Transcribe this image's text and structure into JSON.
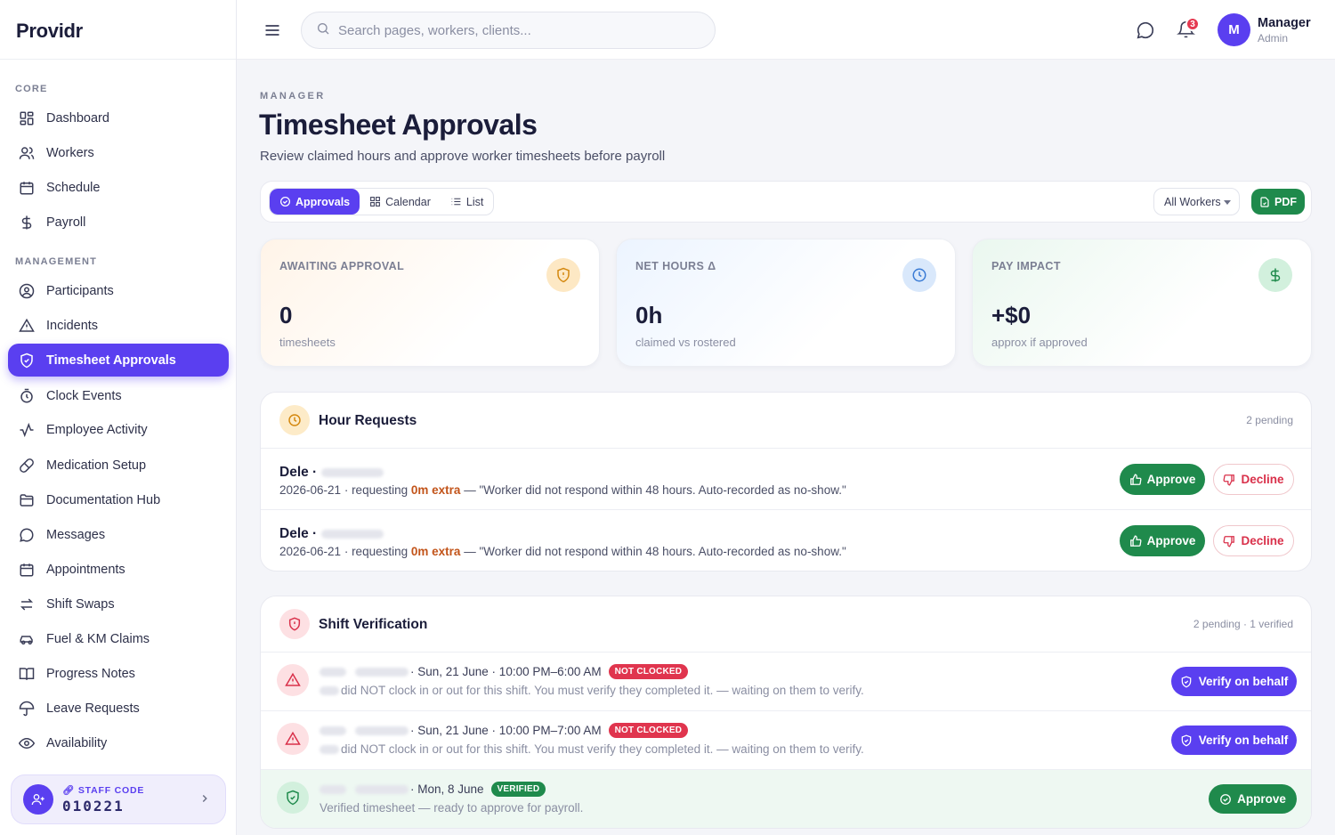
{
  "brand": "Providr",
  "sidebar": {
    "sections": [
      "CORE",
      "MANAGEMENT"
    ],
    "items": [
      {
        "label": "Dashboard",
        "icon": "dashboard-icon"
      },
      {
        "label": "Workers",
        "icon": "users-icon"
      },
      {
        "label": "Schedule",
        "icon": "calendar-icon"
      },
      {
        "label": "Payroll",
        "icon": "dollar-icon"
      },
      {
        "label": "Participants",
        "icon": "user-circle-icon"
      },
      {
        "label": "Incidents",
        "icon": "warning-icon"
      },
      {
        "label": "Timesheet Approvals",
        "icon": "shield-check-icon",
        "active": true
      },
      {
        "label": "Clock Events",
        "icon": "timer-icon"
      },
      {
        "label": "Employee Activity",
        "icon": "activity-icon"
      },
      {
        "label": "Medication Setup",
        "icon": "pill-icon"
      },
      {
        "label": "Documentation Hub",
        "icon": "folder-icon"
      },
      {
        "label": "Messages",
        "icon": "chat-icon"
      },
      {
        "label": "Appointments",
        "icon": "calendar-icon"
      },
      {
        "label": "Shift Swaps",
        "icon": "swap-icon"
      },
      {
        "label": "Fuel & KM Claims",
        "icon": "car-icon"
      },
      {
        "label": "Progress Notes",
        "icon": "book-icon"
      },
      {
        "label": "Leave Requests",
        "icon": "umbrella-icon"
      },
      {
        "label": "Availability",
        "icon": "eye-icon"
      }
    ],
    "staff_code": {
      "label": "STAFF CODE",
      "value": "010221"
    }
  },
  "topbar": {
    "search_placeholder": "Search pages, workers, clients...",
    "notification_count": "3",
    "avatar_initial": "M",
    "user_name": "Manager",
    "user_role": "Admin"
  },
  "page": {
    "eyebrow": "MANAGER",
    "title": "Timesheet Approvals",
    "subtitle": "Review claimed hours and approve worker timesheets before payroll"
  },
  "toolbar": {
    "views": [
      "Approvals",
      "Calendar",
      "List"
    ],
    "active_view": "Approvals",
    "worker_filter": "All Workers",
    "pdf_label": "PDF"
  },
  "stats": [
    {
      "label": "AWAITING APPROVAL",
      "value": "0",
      "sub": "timesheets",
      "icon": "shield-alert-icon",
      "color": "#d4880f"
    },
    {
      "label": "NET HOURS Δ",
      "value": "0h",
      "sub": "claimed vs rostered",
      "icon": "clock-icon",
      "color": "#3a7bd5"
    },
    {
      "label": "PAY IMPACT",
      "value": "+$0",
      "sub": "approx if approved",
      "icon": "dollar-icon",
      "color": "#1f8a4c"
    }
  ],
  "hour_requests": {
    "title": "Hour Requests",
    "meta": "2 pending",
    "rows": [
      {
        "name": "Dele",
        "date": "2026-06-21",
        "requesting": "requesting",
        "extra": "0m extra",
        "note": "— \"Worker did not respond within 48 hours. Auto-recorded as no-show.\"",
        "approve": "Approve",
        "decline": "Decline"
      },
      {
        "name": "Dele",
        "date": "2026-06-21",
        "requesting": "requesting",
        "extra": "0m extra",
        "note": "— \"Worker did not respond within 48 hours. Auto-recorded as no-show.\"",
        "approve": "Approve",
        "decline": "Decline"
      }
    ]
  },
  "shift_verification": {
    "title": "Shift Verification",
    "meta": "2 pending · 1 verified",
    "rows": [
      {
        "shift": "· Sun, 21 June · 10:00 PM–6:00 AM",
        "badge": "NOT CLOCKED",
        "status": "did NOT clock in or out for this shift. You must verify they completed it. — waiting on them to verify.",
        "action": "Verify on behalf",
        "state": "pending"
      },
      {
        "shift": "· Sun, 21 June · 10:00 PM–7:00 AM",
        "badge": "NOT CLOCKED",
        "status": "did NOT clock in or out for this shift. You must verify they completed it. — waiting on them to verify.",
        "action": "Verify on behalf",
        "state": "pending"
      },
      {
        "shift": "· Mon, 8 June",
        "badge": "VERIFIED",
        "status": "Verified timesheet — ready to approve for payroll.",
        "action": "Approve",
        "state": "verified"
      }
    ]
  },
  "colors": {
    "accent": "#5a3ff0",
    "success": "#1f8a4c",
    "danger": "#e0354e"
  }
}
